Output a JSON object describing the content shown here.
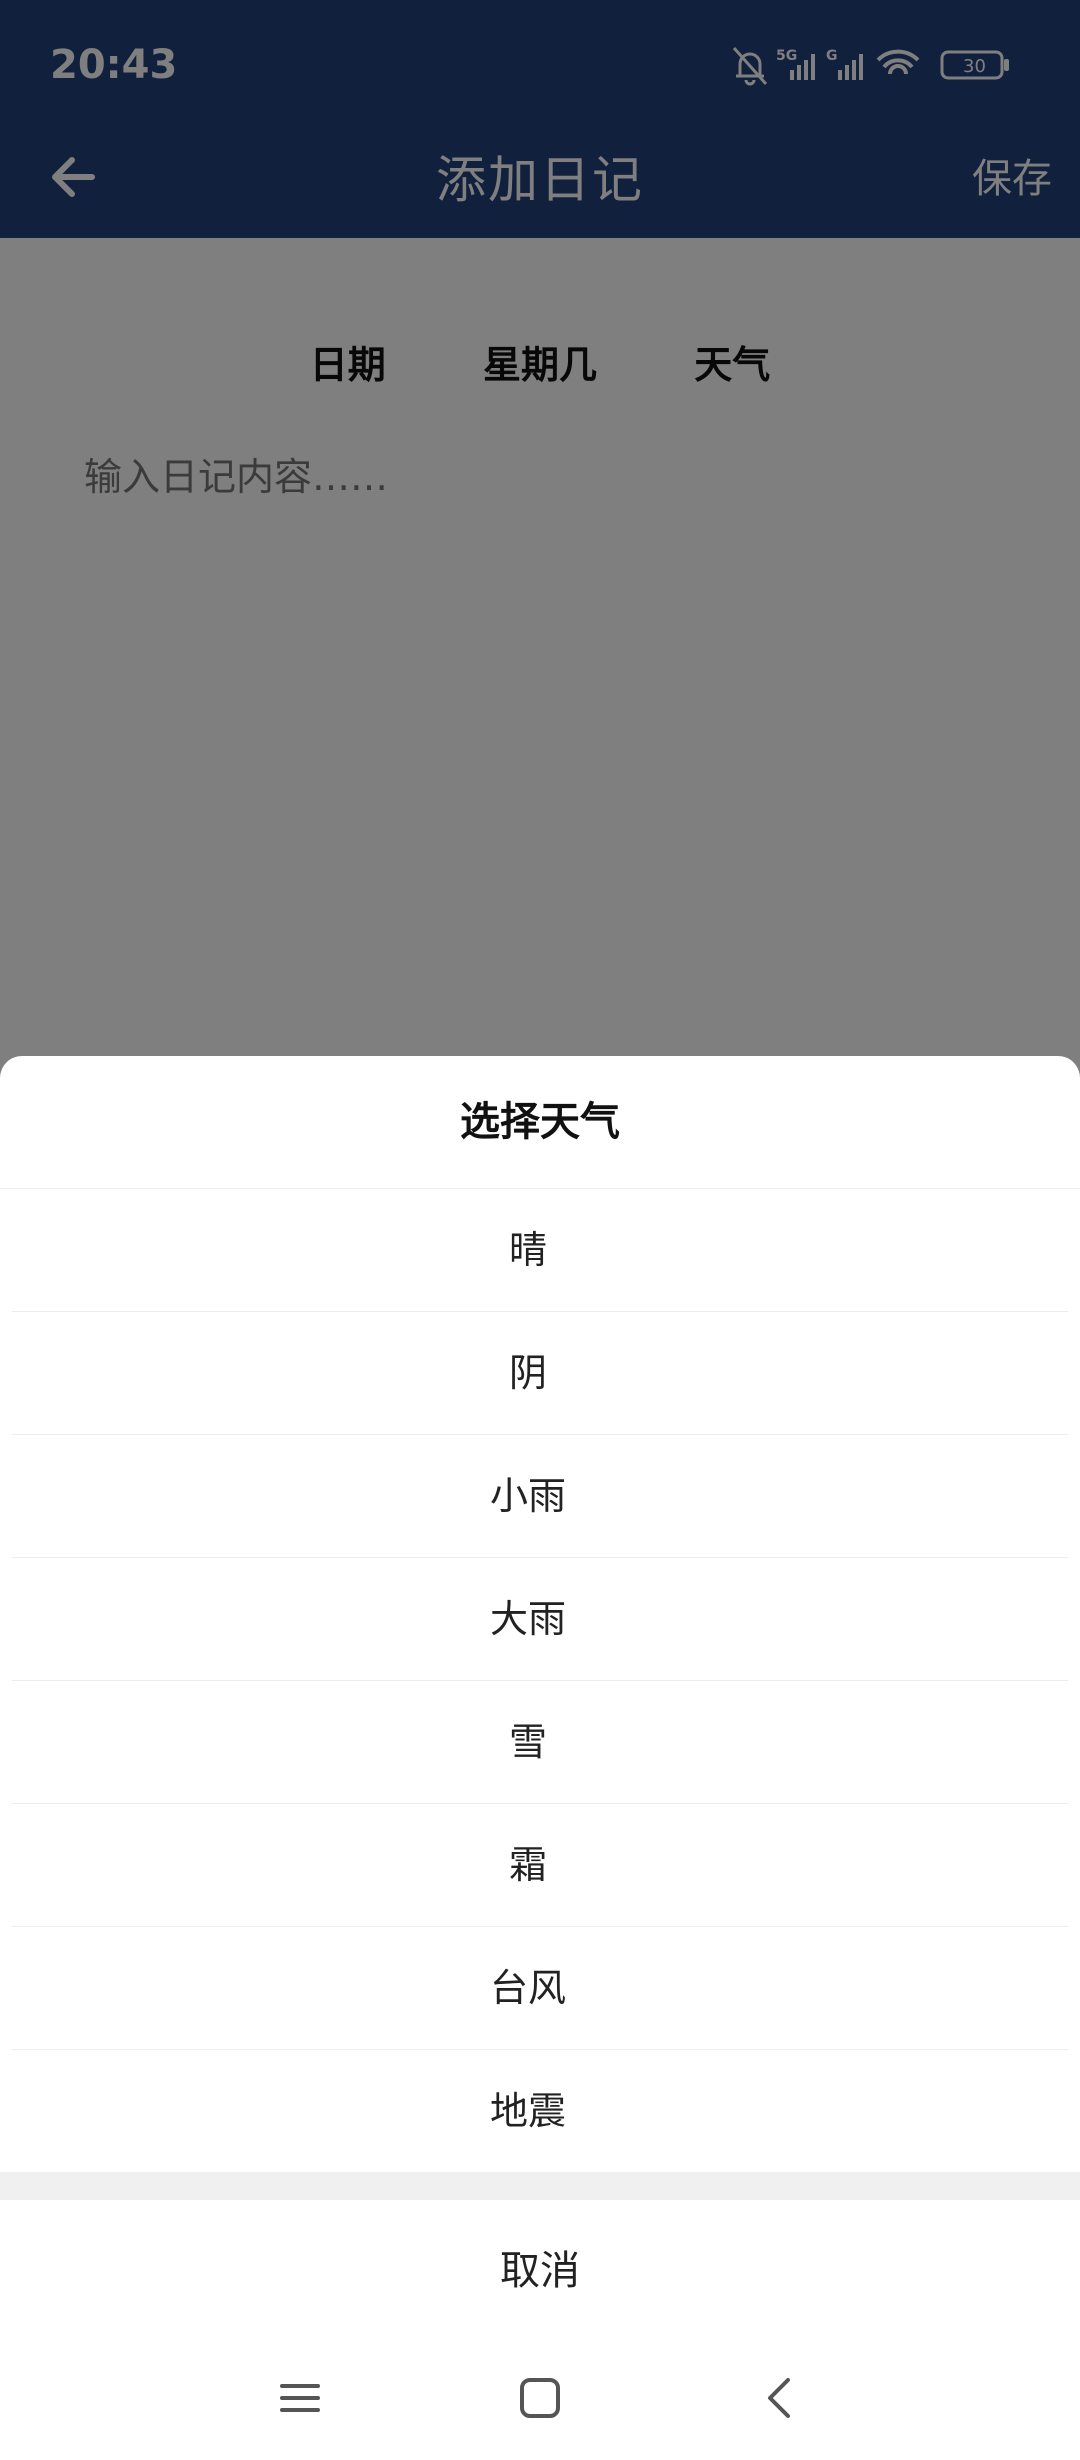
{
  "status": {
    "time": "20:43",
    "network_1": "5G",
    "network_2": "G",
    "battery": "30",
    "icons": [
      "bell-off-icon",
      "signal-5g-icon",
      "signal-icon",
      "wifi-icon",
      "battery-icon"
    ]
  },
  "appbar": {
    "title": "添加日记",
    "save_label": "保存",
    "back_icon": "arrow-left-icon"
  },
  "card": {
    "date_label": "日期",
    "weekday_label": "星期几",
    "weather_label": "天气",
    "placeholder": "输入日记内容……"
  },
  "sheet": {
    "title": "选择天气",
    "options": [
      "晴",
      "阴",
      "小雨",
      "大雨",
      "雪",
      "霜",
      "台风",
      "地震"
    ],
    "cancel_label": "取消"
  },
  "navbar": {
    "icons": [
      "menu-icon",
      "home-icon",
      "back-icon"
    ]
  },
  "colors": {
    "brand": "#21407a",
    "scrim": "rgba(0,0,0,0.5)"
  }
}
